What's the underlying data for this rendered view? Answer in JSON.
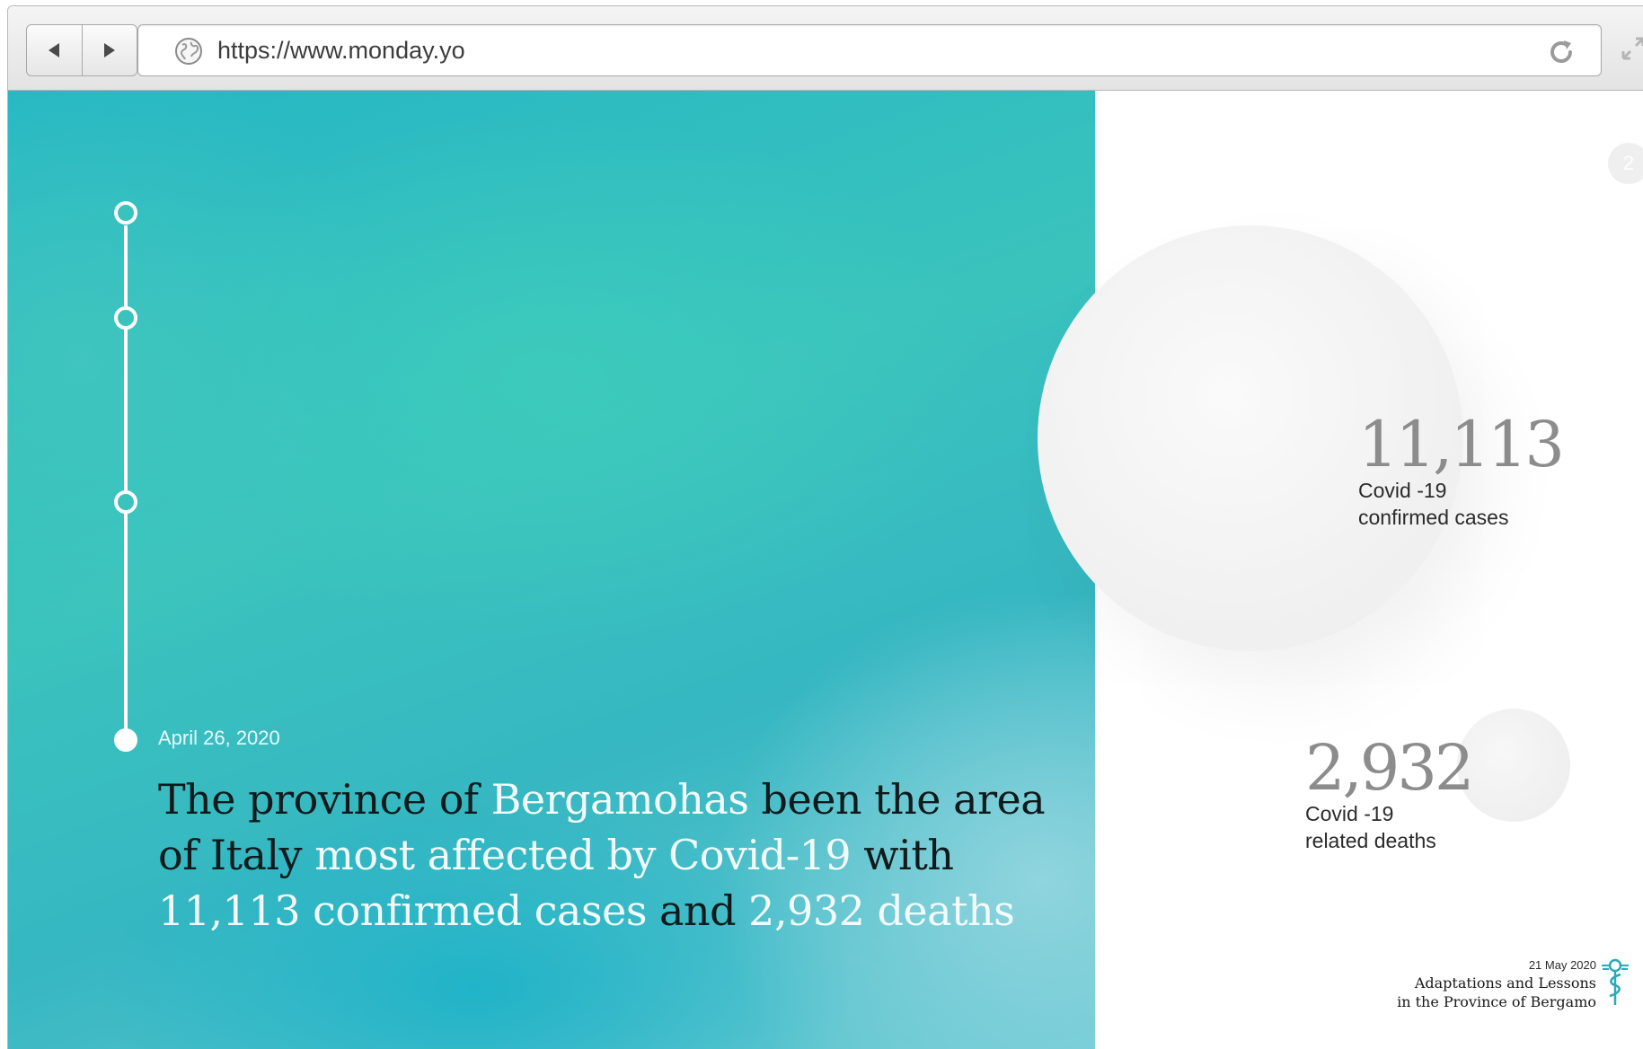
{
  "browser": {
    "url": "https://www.monday.yo",
    "icons": {
      "back": "back-arrow-icon",
      "forward": "forward-arrow-icon",
      "site": "globe-icon",
      "reload": "reload-icon",
      "fullscreen": "expand-icon"
    }
  },
  "page": {
    "badge": "2",
    "timeline": {
      "points": 4,
      "active_index": 3
    },
    "date": "April 26, 2020",
    "headline": [
      {
        "text": "The province of ",
        "highlight": false
      },
      {
        "text": "Bergamohas",
        "highlight": true
      },
      {
        "text": " been the area of Italy ",
        "highlight": false
      },
      {
        "text": "most affected by Covid-19",
        "highlight": true
      },
      {
        "text": " with ",
        "highlight": false
      },
      {
        "text": "11,113 confirmed cases",
        "highlight": true
      },
      {
        "text": " and ",
        "highlight": false
      },
      {
        "text": "2,932 deaths",
        "highlight": true
      }
    ],
    "stats": {
      "cases": {
        "number": "11,113",
        "label_line1": "Covid -19",
        "label_line2": "confirmed cases"
      },
      "deaths": {
        "number": "2,932",
        "label_line1": "Covid -19",
        "label_line2": "related deaths"
      }
    },
    "footer": {
      "date": "21 May 2020",
      "title_line1": "Adaptations and Lessons",
      "title_line2": "in the Province of Bergamo",
      "logo_icon": "caduceus-icon"
    }
  },
  "colors": {
    "hero_teal": "#3ac3bd",
    "highlight_text": "#f2fcfb",
    "stat_number": "#8c8c8c",
    "logo_accent": "#2aa9b8"
  }
}
